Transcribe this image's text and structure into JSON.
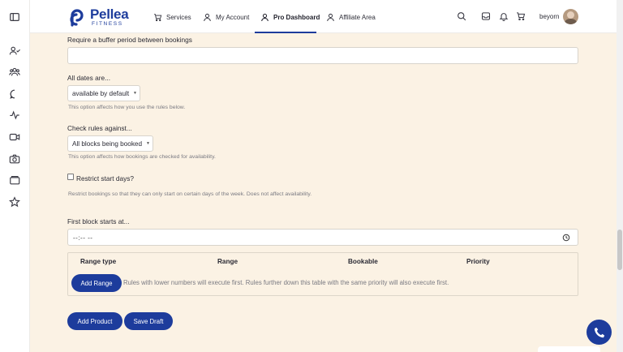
{
  "brand": {
    "name": "Pellea",
    "sub": "FITNESS",
    "color": "#1d3c9c"
  },
  "nav": {
    "items": [
      {
        "label": "Services",
        "icon": "cart-icon"
      },
      {
        "label": "My Account",
        "icon": "user-icon"
      },
      {
        "label": "Pro Dashboard",
        "icon": "user-icon",
        "active": true
      },
      {
        "label": "Affiliate Area",
        "icon": "user-icon"
      }
    ],
    "username": "beyorn"
  },
  "left_rail_icons": [
    "sidebar-toggle-icon",
    "users-icon",
    "group-icon",
    "chat-icon",
    "activity-icon",
    "video-icon",
    "camera-icon",
    "folders-icon",
    "star-icon"
  ],
  "top_icons": [
    "search-icon",
    "inbox-icon",
    "bell-icon",
    "cart-icon"
  ],
  "form": {
    "buffer_label": "Require a buffer period between bookings",
    "buffer_value": "",
    "all_dates_label": "All dates are...",
    "all_dates_value": "available by default",
    "all_dates_help": "This option affects how you use the rules below.",
    "check_rules_label": "Check rules against...",
    "check_rules_value": "All blocks being booked",
    "check_rules_help": "This option affects how bookings are checked for availability.",
    "restrict_label": "Restrict start days?",
    "restrict_checked": false,
    "restrict_help": "Restrict bookings so that they can only start on certain days of the week. Does not affect availability.",
    "first_block_label": "First block starts at...",
    "first_block_value": "--:-- --"
  },
  "range_table": {
    "headers": [
      "Range type",
      "Range",
      "Bookable",
      "Priority"
    ],
    "add_range_label": "Add Range",
    "note": "Rules with lower numbers will execute first. Rules further down this table with the same priority will also execute first."
  },
  "actions": {
    "add_product_label": "Add Product",
    "save_draft_label": "Save Draft"
  }
}
